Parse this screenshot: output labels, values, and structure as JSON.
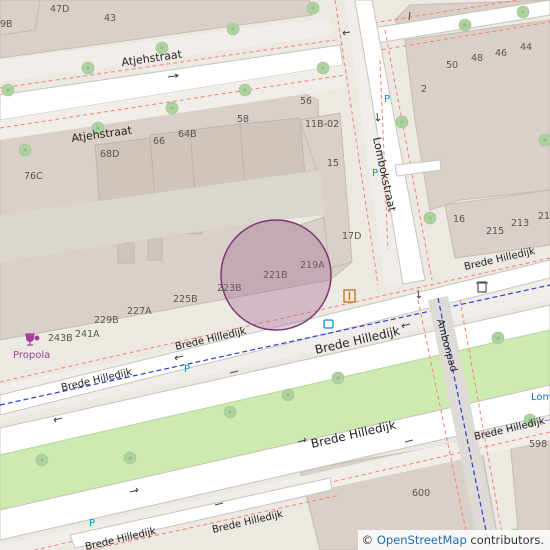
{
  "map": {
    "streets": {
      "atjehstraat_upper": "Atjehstraat",
      "atjehstraat_lower": "Atjehstraat",
      "lombokstraat": "Lombokstraat",
      "brede_hilledijk_1": "Brede Hilledijk",
      "brede_hilledijk_2": "Brede Hilledijk",
      "brede_hilledijk_3": "Brede Hilledijk",
      "brede_hilledijk_4": "Brede Hilledijk",
      "brede_hilledijk_5": "Brede Hilledijk",
      "brede_hilledijk_6": "Brede Hilledijk",
      "brede_hilledijk_7": "Brede Hilledijk",
      "brede_hilledijk_8": "Brede Hilledijk",
      "ambonpad": "Ambonpad",
      "lom_cut": "Lom"
    },
    "house_numbers": {
      "n47d": "47D",
      "n43": "43",
      "n9b": "9B",
      "n56": "56",
      "n58": "58",
      "n11b02": "11B-02",
      "n68d": "68D",
      "n66": "66",
      "n64b": "64B",
      "n76c": "76C",
      "n15": "15",
      "n17d": "17D",
      "n221b": "221B",
      "n219a": "219A",
      "n223b": "223B",
      "n225b": "225B",
      "n227a": "227A",
      "n229b": "229B",
      "n241a": "241A",
      "n243b": "243B",
      "n50": "50",
      "n48": "48",
      "n46": "46",
      "n44": "44",
      "n2": "2",
      "n16": "16",
      "n215": "215",
      "n213": "213",
      "n21": "21",
      "n598": "598",
      "n600": "600"
    },
    "poi": {
      "propola": "Propola"
    },
    "parking": "P",
    "colors": {
      "building": "#d9d0c9",
      "building_stroke": "#c5bbb2",
      "ground": "#ece8e2",
      "road": "#ffffff",
      "road_edge": "#c9c3bb",
      "grass": "#cdebb0",
      "tree": "#aed1a0",
      "cycle": "#2c3fd1",
      "sidewalk": "#fa8072",
      "marker_fill": "#9b5d8c",
      "marker_stroke": "#7b3a73",
      "propola": "#a33e9b"
    },
    "marker": {
      "shape": "circle"
    }
  },
  "attribution": {
    "prefix": "© ",
    "link": "OpenStreetMap",
    "suffix": " contributors."
  }
}
